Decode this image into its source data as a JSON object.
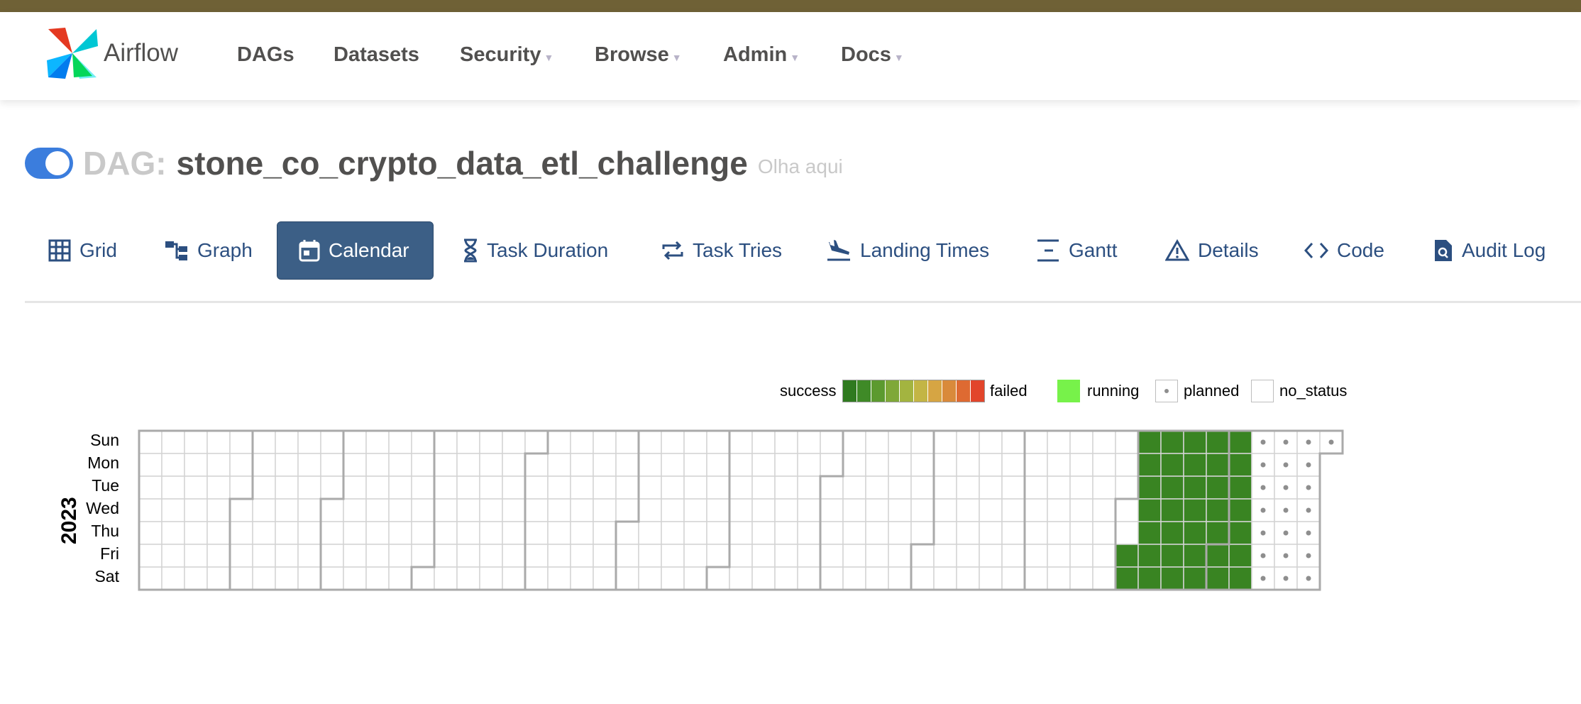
{
  "brand": {
    "name": "Airflow"
  },
  "nav": {
    "items": [
      {
        "label": "DAGs",
        "dropdown": false
      },
      {
        "label": "Datasets",
        "dropdown": false
      },
      {
        "label": "Security",
        "dropdown": true
      },
      {
        "label": "Browse",
        "dropdown": true
      },
      {
        "label": "Admin",
        "dropdown": true
      },
      {
        "label": "Docs",
        "dropdown": true
      }
    ]
  },
  "dag": {
    "prefix": "DAG:",
    "id": "stone_co_crypto_data_etl_challenge",
    "description": "Olha aqui",
    "active": true
  },
  "tabs": [
    {
      "label": "Grid",
      "icon": "grid-icon",
      "active": false
    },
    {
      "label": "Graph",
      "icon": "graph-icon",
      "active": false
    },
    {
      "label": "Calendar",
      "icon": "calendar-icon",
      "active": true
    },
    {
      "label": "Task Duration",
      "icon": "hourglass-icon",
      "active": false
    },
    {
      "label": "Task Tries",
      "icon": "repeat-icon",
      "active": false
    },
    {
      "label": "Landing Times",
      "icon": "plane-landing-icon",
      "active": false
    },
    {
      "label": "Gantt",
      "icon": "gantt-icon",
      "active": false
    },
    {
      "label": "Details",
      "icon": "warning-triangle-icon",
      "active": false
    },
    {
      "label": "Code",
      "icon": "code-icon",
      "active": false
    },
    {
      "label": "Audit Log",
      "icon": "file-search-icon",
      "active": false
    }
  ],
  "legend": {
    "success": "success",
    "failed": "failed",
    "running": "running",
    "planned": "planned",
    "no_status": "no_status",
    "scale_colors": [
      "#2f7a1f",
      "#3f8a27",
      "#5c9a2f",
      "#7fa838",
      "#a3b440",
      "#c3b545",
      "#d6a543",
      "#d98a3b",
      "#de6a32",
      "#e2452b"
    ],
    "running_color": "#77f24a"
  },
  "calendar": {
    "year": "2023",
    "days": [
      "Sun",
      "Mon",
      "Tue",
      "Wed",
      "Thu",
      "Fri",
      "Sat"
    ],
    "success_color": "#398422",
    "success_range": [
      "2023-11-03",
      "2023-12-09"
    ],
    "planned_range": [
      "2023-12-10",
      "2023-12-31"
    ]
  }
}
